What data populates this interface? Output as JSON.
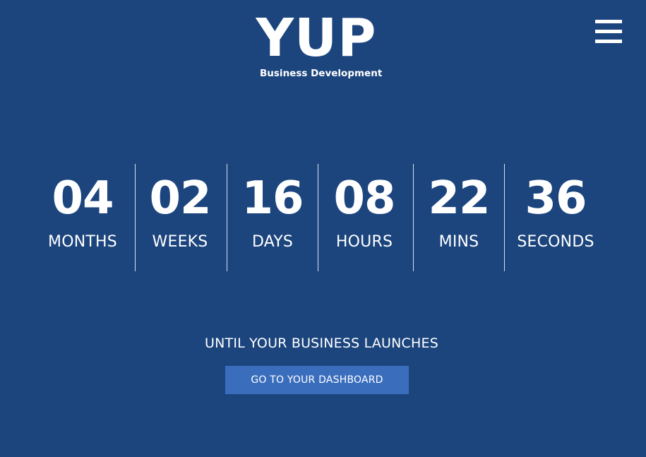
{
  "header": {
    "logo_title": "YUP",
    "logo_subtitle": "Business Development",
    "menu_icon": "hamburger-menu-icon"
  },
  "countdown": [
    {
      "value": "04",
      "label": "MONTHS"
    },
    {
      "value": "02",
      "label": "WEEKS"
    },
    {
      "value": "16",
      "label": "DAYS"
    },
    {
      "value": "08",
      "label": "HOURS"
    },
    {
      "value": "22",
      "label": "MINS"
    },
    {
      "value": "36",
      "label": "SECONDS"
    }
  ],
  "tagline": "UNTIL YOUR BUSINESS LAUNCHES",
  "cta": {
    "label": "GO TO YOUR DASHBOARD"
  },
  "colors": {
    "background": "#1c457e",
    "button": "#3a6ebd",
    "text": "#ffffff"
  }
}
